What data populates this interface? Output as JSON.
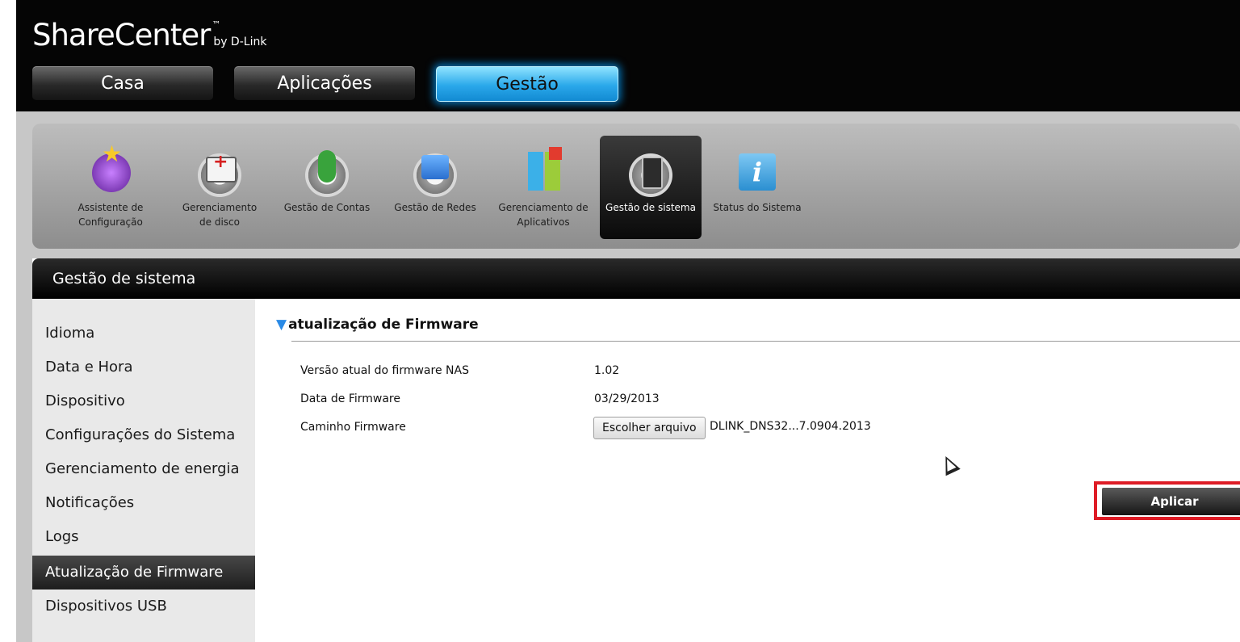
{
  "brand": {
    "name": "ShareCenter",
    "tm": "™",
    "by": "by D-Link"
  },
  "nav": {
    "tabs": [
      {
        "label": "Casa"
      },
      {
        "label": "Aplicações"
      },
      {
        "label": "Gestão"
      }
    ],
    "active": "Gestão"
  },
  "toolbar": {
    "items": [
      {
        "label": "Assistente de\nConfiguração",
        "icon": "wizard-icon"
      },
      {
        "label": "Gerenciamento\nde disco",
        "icon": "disk-management-icon"
      },
      {
        "label": "Gestão de Contas",
        "icon": "accounts-icon"
      },
      {
        "label": "Gestão de Redes",
        "icon": "network-icon"
      },
      {
        "label": "Gerenciamento de\nAplicativos",
        "icon": "applications-icon"
      },
      {
        "label": "Gestão de sistema",
        "icon": "system-management-icon"
      },
      {
        "label": "Status do Sistema",
        "icon": "info-icon"
      }
    ],
    "active": "Gestão de sistema"
  },
  "panel": {
    "title": "Gestão de sistema"
  },
  "sidebar": {
    "items": [
      {
        "label": "Idioma"
      },
      {
        "label": "Data e Hora"
      },
      {
        "label": "Dispositivo"
      },
      {
        "label": "Configurações do Sistema"
      },
      {
        "label": "Gerenciamento de energia"
      },
      {
        "label": "Notificações"
      },
      {
        "label": "Logs"
      },
      {
        "label": "Atualização de Firmware"
      },
      {
        "label": "Dispositivos USB"
      }
    ],
    "active": "Atualização de Firmware"
  },
  "firmware": {
    "section_title": "atualização de Firmware",
    "version_label": "Versão atual do firmware NAS",
    "version_value": "1.02",
    "date_label": "Data de Firmware",
    "date_value": "03/29/2013",
    "path_label": "Caminho Firmware",
    "choose_button": "Escolher arquivo",
    "file_name": "DLINK_DNS32...7.0904.2013",
    "apply_button": "Aplicar"
  },
  "colors": {
    "accent": "#2aa8ea",
    "highlight": "#de1c26"
  }
}
